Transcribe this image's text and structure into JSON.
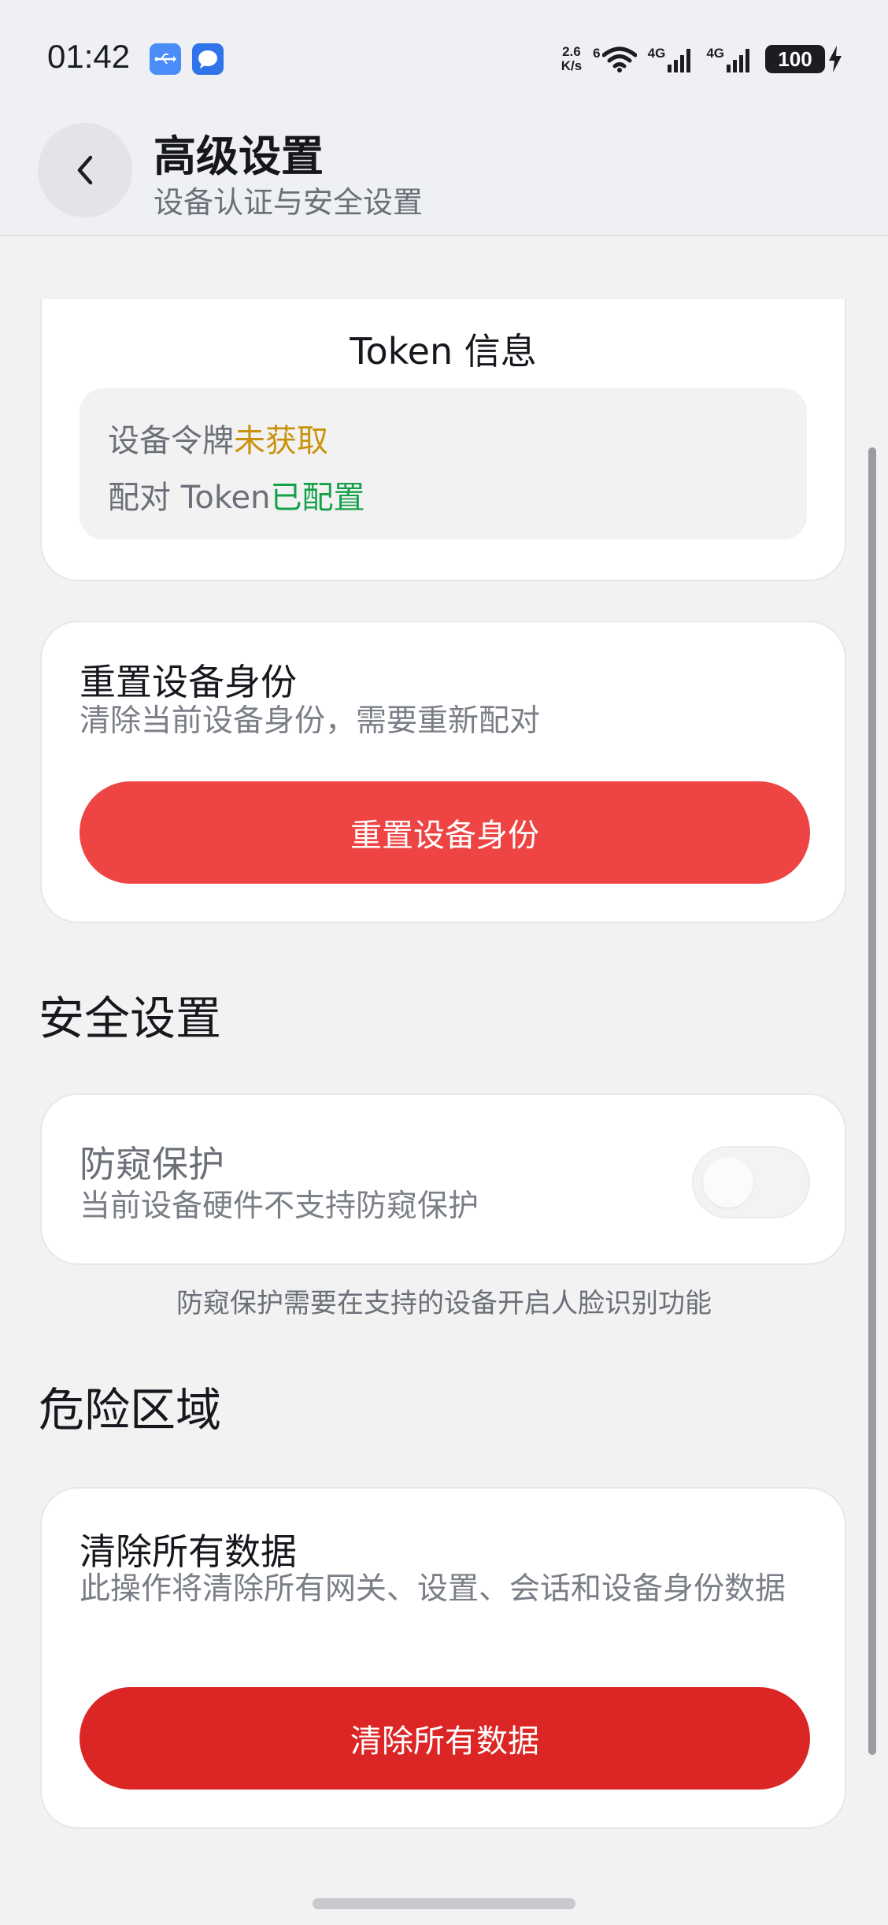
{
  "status_bar": {
    "time": "01:42",
    "net_speed_value": "2.6",
    "net_speed_unit": "K/s",
    "wifi_label": "6",
    "sim1_label": "4G",
    "sim2_label": "4G",
    "battery": "100"
  },
  "header": {
    "title": "高级设置",
    "subtitle": "设备认证与安全设置"
  },
  "token_card": {
    "title": "Token 信息",
    "device_token_label": "设备令牌",
    "device_token_status": "未获取",
    "pair_token_label": "配对 Token",
    "pair_token_status": "已配置"
  },
  "reset_card": {
    "title": "重置设备身份",
    "description": "清除当前设备身份，需要重新配对",
    "button_label": "重置设备身份"
  },
  "security_section": {
    "title": "安全设置",
    "privacy_title": "防窥保护",
    "privacy_desc": "当前设备硬件不支持防窥保护",
    "privacy_enabled": false,
    "privacy_hint": "防窥保护需要在支持的设备开启人脸识别功能"
  },
  "danger_section": {
    "title": "危险区域",
    "clear_title": "清除所有数据",
    "clear_desc": "此操作将清除所有网关、设置、会话和设备身份数据",
    "clear_button_label": "清除所有数据"
  },
  "colors": {
    "reset_button": "#ef4444",
    "clear_button": "#dc2626",
    "status_warn": "#c9930d",
    "status_ok": "#16a04a"
  }
}
